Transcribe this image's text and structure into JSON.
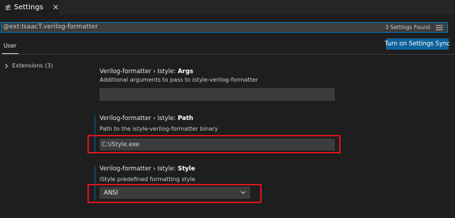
{
  "tab": {
    "label": "Settings",
    "close": "✕"
  },
  "search": {
    "query": "@ext:IsaacT.verilog-formatter",
    "results": "3 Settings Found"
  },
  "scope": {
    "user": "User",
    "sync_button": "Turn on Settings Sync"
  },
  "tree": {
    "extensions": "Extensions (3)"
  },
  "settings": [
    {
      "prefix": "Verilog-formatter › Istyle: ",
      "key": "Args",
      "description": "Additional arguments to pass to istyle-verilog-formatter",
      "value": ""
    },
    {
      "prefix": "Verilog-formatter › Istyle: ",
      "key": "Path",
      "description": "Path to the istyle-verilog-formatter binary",
      "value": "C:\\iStyle.exe"
    },
    {
      "prefix": "Verilog-formatter › Istyle: ",
      "key": "Style",
      "description": "iStyle predefined formatting style",
      "value": "ANSI"
    }
  ],
  "colors": {
    "accent": "#0e639c",
    "highlight": "#e0141e",
    "background": "#1e1e1e"
  },
  "icons": {
    "tab": "settings-file-icon",
    "filter": "filter-list-icon",
    "tree": "chevron-right-icon",
    "select": "chevron-down-icon"
  }
}
